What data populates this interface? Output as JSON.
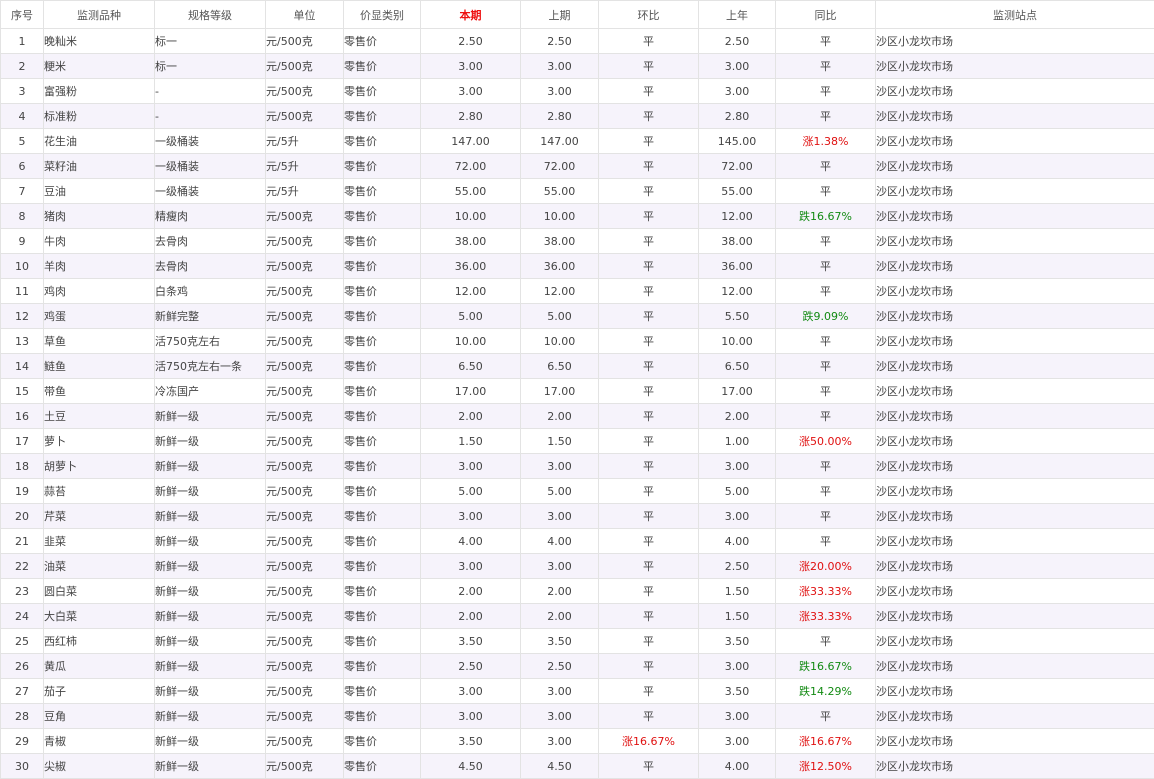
{
  "table": {
    "columns": [
      "序号",
      "监测品种",
      "规格等级",
      "单位",
      "价显类别",
      "本期",
      "上期",
      "环比",
      "上年",
      "同比",
      "监测站点"
    ],
    "rows": [
      [
        "1",
        "晚籼米",
        "标一",
        "元/500克",
        "零售价",
        "2.50",
        "2.50",
        "平",
        "2.50",
        "平",
        "沙区小龙坎市场"
      ],
      [
        "2",
        "粳米",
        "标一",
        "元/500克",
        "零售价",
        "3.00",
        "3.00",
        "平",
        "3.00",
        "平",
        "沙区小龙坎市场"
      ],
      [
        "3",
        "富强粉",
        "-",
        "元/500克",
        "零售价",
        "3.00",
        "3.00",
        "平",
        "3.00",
        "平",
        "沙区小龙坎市场"
      ],
      [
        "4",
        "标准粉",
        "-",
        "元/500克",
        "零售价",
        "2.80",
        "2.80",
        "平",
        "2.80",
        "平",
        "沙区小龙坎市场"
      ],
      [
        "5",
        "花生油",
        "一级桶装",
        "元/5升",
        "零售价",
        "147.00",
        "147.00",
        "平",
        "145.00",
        "涨1.38%",
        "沙区小龙坎市场"
      ],
      [
        "6",
        "菜籽油",
        "一级桶装",
        "元/5升",
        "零售价",
        "72.00",
        "72.00",
        "平",
        "72.00",
        "平",
        "沙区小龙坎市场"
      ],
      [
        "7",
        "豆油",
        "一级桶装",
        "元/5升",
        "零售价",
        "55.00",
        "55.00",
        "平",
        "55.00",
        "平",
        "沙区小龙坎市场"
      ],
      [
        "8",
        "猪肉",
        "精瘦肉",
        "元/500克",
        "零售价",
        "10.00",
        "10.00",
        "平",
        "12.00",
        "跌16.67%",
        "沙区小龙坎市场"
      ],
      [
        "9",
        "牛肉",
        "去骨肉",
        "元/500克",
        "零售价",
        "38.00",
        "38.00",
        "平",
        "38.00",
        "平",
        "沙区小龙坎市场"
      ],
      [
        "10",
        "羊肉",
        "去骨肉",
        "元/500克",
        "零售价",
        "36.00",
        "36.00",
        "平",
        "36.00",
        "平",
        "沙区小龙坎市场"
      ],
      [
        "11",
        "鸡肉",
        "白条鸡",
        "元/500克",
        "零售价",
        "12.00",
        "12.00",
        "平",
        "12.00",
        "平",
        "沙区小龙坎市场"
      ],
      [
        "12",
        "鸡蛋",
        "新鲜完整",
        "元/500克",
        "零售价",
        "5.00",
        "5.00",
        "平",
        "5.50",
        "跌9.09%",
        "沙区小龙坎市场"
      ],
      [
        "13",
        "草鱼",
        "活750克左右",
        "元/500克",
        "零售价",
        "10.00",
        "10.00",
        "平",
        "10.00",
        "平",
        "沙区小龙坎市场"
      ],
      [
        "14",
        "鲢鱼",
        "活750克左右一条",
        "元/500克",
        "零售价",
        "6.50",
        "6.50",
        "平",
        "6.50",
        "平",
        "沙区小龙坎市场"
      ],
      [
        "15",
        "带鱼",
        "冷冻国产",
        "元/500克",
        "零售价",
        "17.00",
        "17.00",
        "平",
        "17.00",
        "平",
        "沙区小龙坎市场"
      ],
      [
        "16",
        "土豆",
        "新鲜一级",
        "元/500克",
        "零售价",
        "2.00",
        "2.00",
        "平",
        "2.00",
        "平",
        "沙区小龙坎市场"
      ],
      [
        "17",
        "萝卜",
        "新鲜一级",
        "元/500克",
        "零售价",
        "1.50",
        "1.50",
        "平",
        "1.00",
        "涨50.00%",
        "沙区小龙坎市场"
      ],
      [
        "18",
        "胡萝卜",
        "新鲜一级",
        "元/500克",
        "零售价",
        "3.00",
        "3.00",
        "平",
        "3.00",
        "平",
        "沙区小龙坎市场"
      ],
      [
        "19",
        "蒜苔",
        "新鲜一级",
        "元/500克",
        "零售价",
        "5.00",
        "5.00",
        "平",
        "5.00",
        "平",
        "沙区小龙坎市场"
      ],
      [
        "20",
        "芹菜",
        "新鲜一级",
        "元/500克",
        "零售价",
        "3.00",
        "3.00",
        "平",
        "3.00",
        "平",
        "沙区小龙坎市场"
      ],
      [
        "21",
        "韭菜",
        "新鲜一级",
        "元/500克",
        "零售价",
        "4.00",
        "4.00",
        "平",
        "4.00",
        "平",
        "沙区小龙坎市场"
      ],
      [
        "22",
        "油菜",
        "新鲜一级",
        "元/500克",
        "零售价",
        "3.00",
        "3.00",
        "平",
        "2.50",
        "涨20.00%",
        "沙区小龙坎市场"
      ],
      [
        "23",
        "圆白菜",
        "新鲜一级",
        "元/500克",
        "零售价",
        "2.00",
        "2.00",
        "平",
        "1.50",
        "涨33.33%",
        "沙区小龙坎市场"
      ],
      [
        "24",
        "大白菜",
        "新鲜一级",
        "元/500克",
        "零售价",
        "2.00",
        "2.00",
        "平",
        "1.50",
        "涨33.33%",
        "沙区小龙坎市场"
      ],
      [
        "25",
        "西红柿",
        "新鲜一级",
        "元/500克",
        "零售价",
        "3.50",
        "3.50",
        "平",
        "3.50",
        "平",
        "沙区小龙坎市场"
      ],
      [
        "26",
        "黄瓜",
        "新鲜一级",
        "元/500克",
        "零售价",
        "2.50",
        "2.50",
        "平",
        "3.00",
        "跌16.67%",
        "沙区小龙坎市场"
      ],
      [
        "27",
        "茄子",
        "新鲜一级",
        "元/500克",
        "零售价",
        "3.00",
        "3.00",
        "平",
        "3.50",
        "跌14.29%",
        "沙区小龙坎市场"
      ],
      [
        "28",
        "豆角",
        "新鲜一级",
        "元/500克",
        "零售价",
        "3.00",
        "3.00",
        "平",
        "3.00",
        "平",
        "沙区小龙坎市场"
      ],
      [
        "29",
        "青椒",
        "新鲜一级",
        "元/500克",
        "零售价",
        "3.50",
        "3.00",
        "涨16.67%",
        "3.00",
        "涨16.67%",
        "沙区小龙坎市场"
      ],
      [
        "30",
        "尖椒",
        "新鲜一级",
        "元/500克",
        "零售价",
        "4.50",
        "4.50",
        "平",
        "4.00",
        "涨12.50%",
        "沙区小龙坎市场"
      ]
    ]
  },
  "colors": {
    "rise": "#e01010",
    "fall": "#128a12",
    "current_header": "#ee1111",
    "stripe": "#f6f3fb"
  }
}
